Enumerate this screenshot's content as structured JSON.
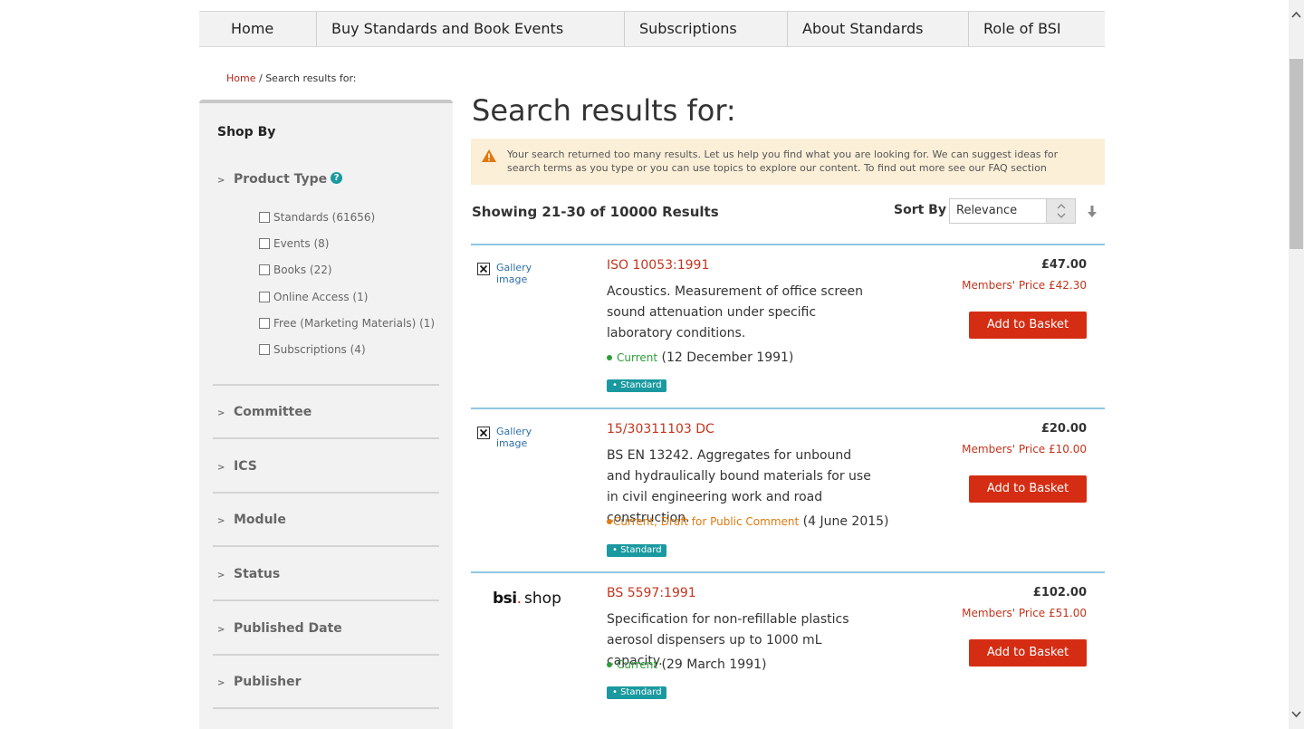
{
  "nav": {
    "items": [
      "Home",
      "Buy Standards and Book Events",
      "Subscriptions",
      "About Standards",
      "Role of BSI"
    ]
  },
  "breadcrumb": {
    "home": "Home",
    "separator": "/",
    "current": "Search results for:"
  },
  "sidebar": {
    "shop_by": "Shop By",
    "product_type": {
      "label": "Product Type",
      "help_icon": "?",
      "options": [
        {
          "label": "Standards (61656)",
          "checked": false
        },
        {
          "label": "Events (8)",
          "checked": false
        },
        {
          "label": "Books (22)",
          "checked": false
        },
        {
          "label": "Online Access (1)",
          "checked": false
        },
        {
          "label": "Free (Marketing Materials) (1)",
          "checked": false
        },
        {
          "label": "Subscriptions (4)",
          "checked": false
        }
      ]
    },
    "groups": [
      "Committee",
      "ICS",
      "Module",
      "Status",
      "Published Date",
      "Publisher"
    ],
    "chevron": ">"
  },
  "main": {
    "title": "Search results for:",
    "alert": "Your search returned too many results. Let us help you find what you are looking for. We can suggest ideas for search terms as you type or you can use topics to explore our content. To find out more see our FAQ section",
    "results_count": "Showing 21-30 of 10000 Results",
    "sort_label": "Sort By",
    "sort_value": "Relevance"
  },
  "results": [
    {
      "thumb": "Gallery image",
      "code": "ISO 10053:1991",
      "description": "Acoustics. Measurement of office screen sound attenuation under specific laboratory conditions.",
      "status": "Current",
      "status_color": "#2d9e3a",
      "date": "(12 December 1991)",
      "tag": "Standard",
      "price": "£47.00",
      "member_label": "Members' Price",
      "member_price": "£42.30",
      "button": "Add to Basket"
    },
    {
      "thumb": "Gallery image",
      "code": "15/30311103 DC",
      "description": "BS EN 13242. Aggregates for unbound and hydraulically bound materials for use in civil engineering work and road construction.",
      "status": "Current, Draft for Public Comment",
      "status_color": "#e07a10",
      "date": "(4 June 2015)",
      "tag": "Standard",
      "price": "£20.00",
      "member_label": "Members' Price",
      "member_price": "£10.00",
      "button": "Add to Basket"
    },
    {
      "logo_brand": "bsi",
      "logo_dot": ".",
      "logo_suffix": "shop",
      "code": "BS 5597:1991",
      "description": "Specification for non-refillable plastics aerosol dispensers up to 1000 mL capacity.",
      "status": "Current",
      "status_color": "#2d9e3a",
      "date": "(29 March 1991)",
      "tag": "Standard",
      "price": "£102.00",
      "member_label": "Members' Price",
      "member_price": "£51.00",
      "button": "Add to Basket"
    }
  ],
  "colors": {
    "accent_red": "#d42d13",
    "link_red": "#c5341c",
    "teal": "#1a9aa0",
    "alert_bg": "#fcefd8",
    "divider_blue": "#8fc6e0"
  }
}
